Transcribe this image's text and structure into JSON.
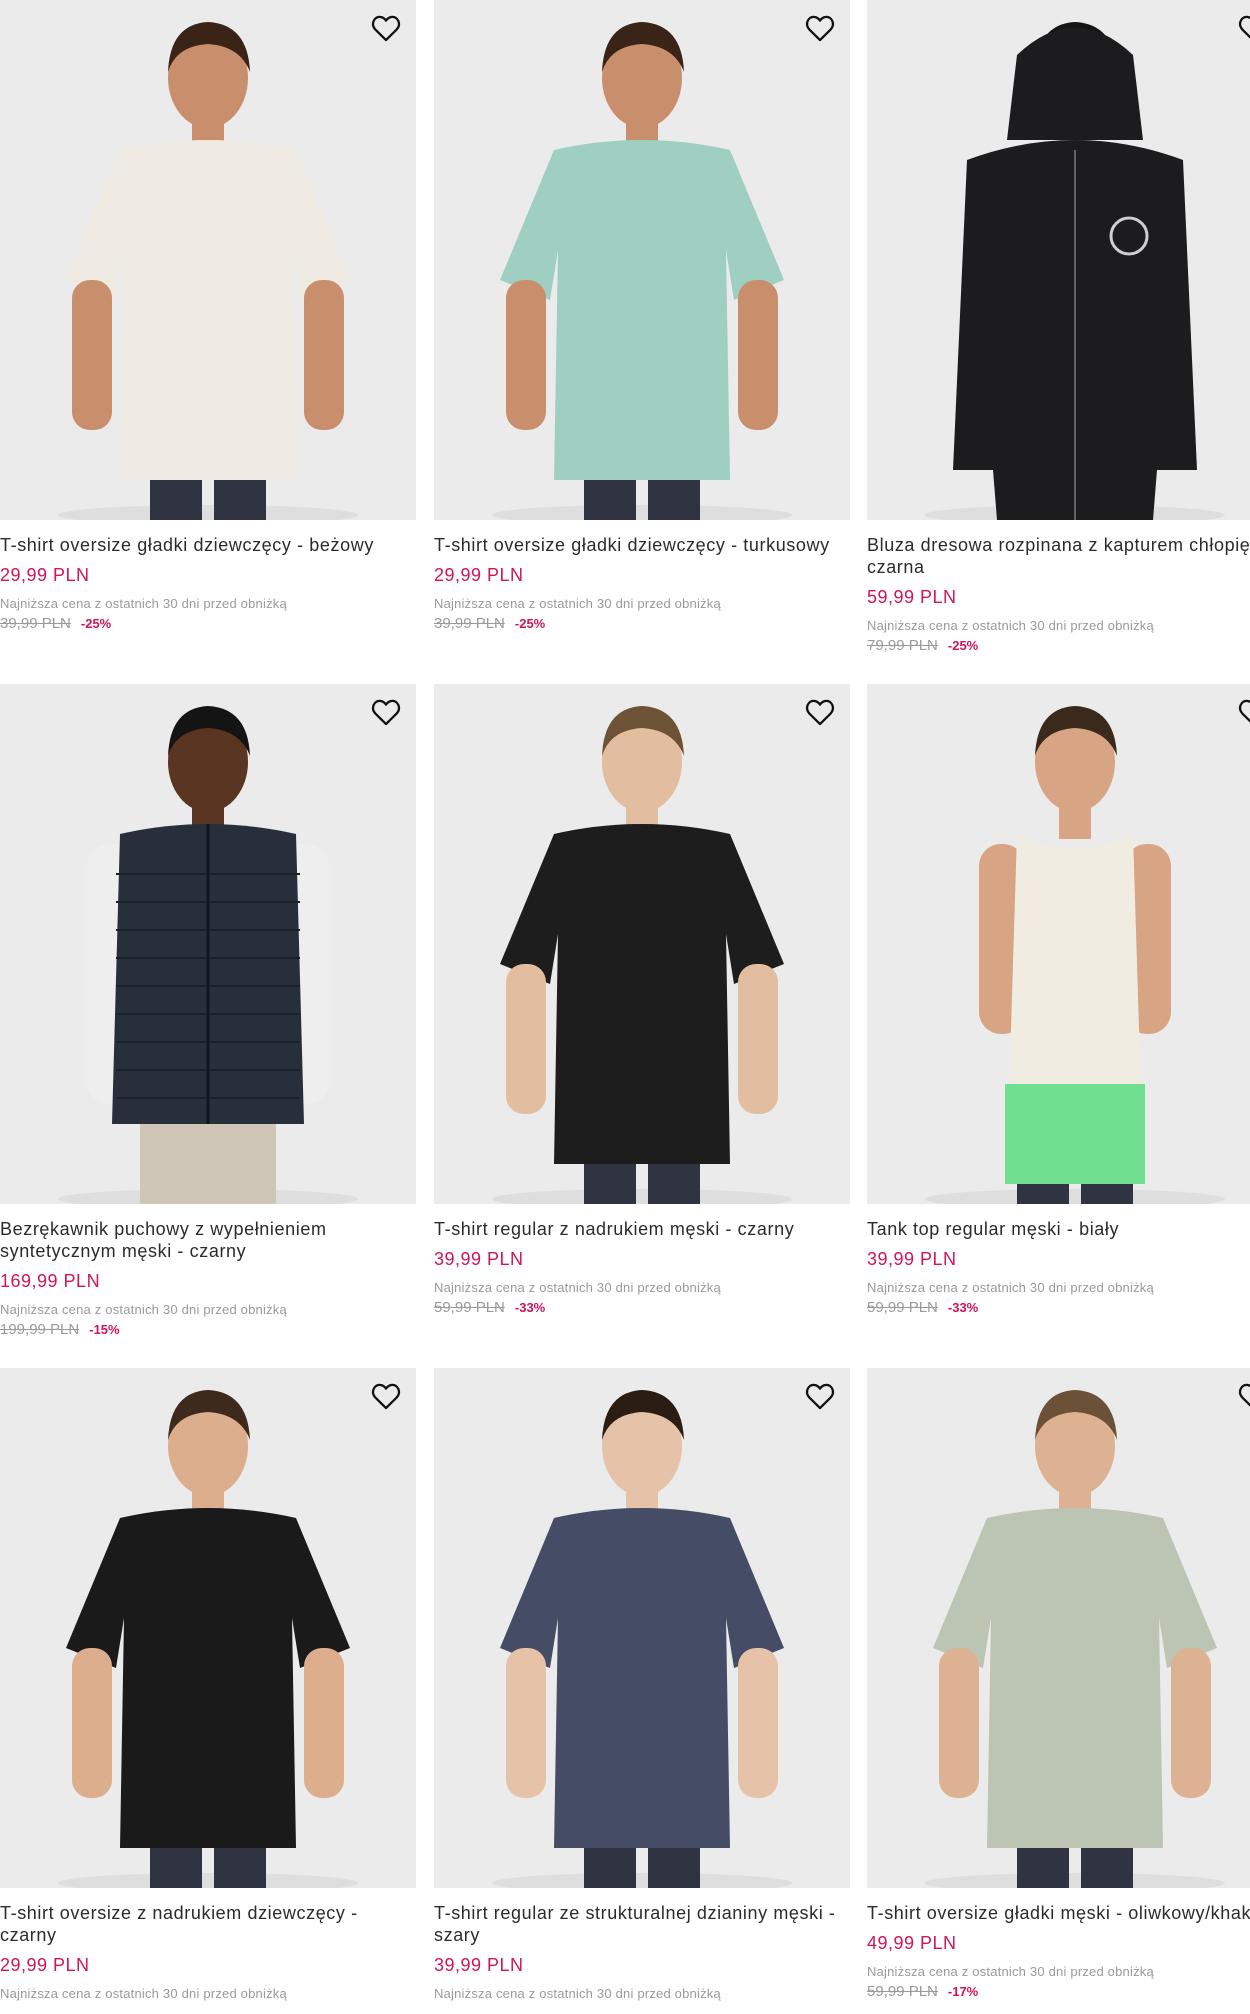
{
  "colors": {
    "price": "#d0145a",
    "muted": "#9a9a9a",
    "image_bg": "#ebebeb"
  },
  "products": [
    {
      "name": "T-shirt oversize gładki dziewczęcy - beżowy",
      "price": "29,99 PLN",
      "lowest_label": "Najniższa cena z ostatnich 30 dni przed obniżką",
      "old_price": "39,99 PLN",
      "discount": "-25%",
      "garment": "tee",
      "color": "#efebe2",
      "skin": "#c98f6c",
      "hair": "#3a2418"
    },
    {
      "name": "T-shirt oversize gładki dziewczęcy - turkusowy",
      "price": "29,99 PLN",
      "lowest_label": "Najniższa cena z ostatnich 30 dni przed obniżką",
      "old_price": "39,99 PLN",
      "discount": "-25%",
      "garment": "tee",
      "color": "#9fcfc1",
      "skin": "#c98f6c",
      "hair": "#3a2418"
    },
    {
      "name": "Bluza dresowa rozpinana z kapturem chłopięca - czarna",
      "price": "59,99 PLN",
      "lowest_label": "Najniższa cena z ostatnich 30 dni przed obniżką",
      "old_price": "79,99 PLN",
      "discount": "-25%",
      "garment": "hoodie",
      "color": "#1c1c1e",
      "skin": "#e2bc9a",
      "hair": "#151515"
    },
    {
      "name": "Bezrękawnik puchowy z wypełnieniem syntetycznym męski - czarny",
      "price": "169,99 PLN",
      "lowest_label": "Najniższa cena z ostatnich 30 dni przed obniżką",
      "old_price": "199,99 PLN",
      "discount": "-15%",
      "garment": "vest",
      "color": "#27303a",
      "skin": "#5a3521",
      "hair": "#141414"
    },
    {
      "name": "T-shirt regular z nadrukiem męski - czarny",
      "price": "39,99 PLN",
      "lowest_label": "Najniższa cena z ostatnich 30 dni przed obniżką",
      "old_price": "59,99 PLN",
      "discount": "-33%",
      "garment": "tee",
      "color": "#1d1d1d",
      "skin": "#e3bd9f",
      "hair": "#6d5236"
    },
    {
      "name": "Tank top regular męski - biały",
      "price": "39,99 PLN",
      "lowest_label": "Najniższa cena z ostatnich 30 dni przed obniżką",
      "old_price": "59,99 PLN",
      "discount": "-33%",
      "garment": "tank",
      "color": "#f0ece2",
      "skin": "#d8a584",
      "hair": "#3b2a1c"
    },
    {
      "name": "T-shirt oversize z nadrukiem dziewczęcy - czarny",
      "price": "29,99 PLN",
      "lowest_label": "Najniższa cena z ostatnich 30 dni przed obniżką",
      "old_price": "",
      "discount": "",
      "garment": "tee",
      "color": "#1a1a1a",
      "skin": "#dcae8e",
      "hair": "#3e2a1c"
    },
    {
      "name": "T-shirt regular ze strukturalnej dzianiny męski - szary",
      "price": "39,99 PLN",
      "lowest_label": "Najniższa cena z ostatnich 30 dni przed obniżką",
      "old_price": "",
      "discount": "",
      "garment": "tee",
      "color": "#454d66",
      "skin": "#e6c3a8",
      "hair": "#2a1d14"
    },
    {
      "name": "T-shirt oversize gładki męski - oliwkowy/khaki",
      "price": "49,99 PLN",
      "lowest_label": "Najniższa cena z ostatnich 30 dni przed obniżką",
      "old_price": "59,99 PLN",
      "discount": "-17%",
      "garment": "tee",
      "color": "#bcc4b4",
      "skin": "#dcb293",
      "hair": "#6b5138"
    }
  ]
}
